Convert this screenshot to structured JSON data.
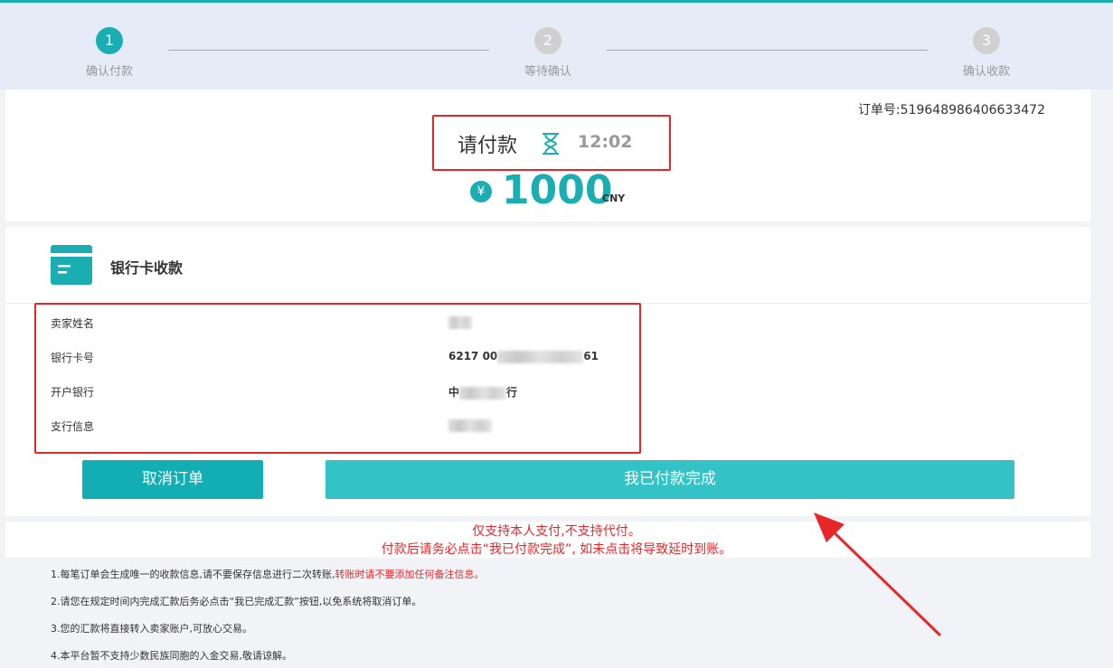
{
  "steps": [
    {
      "num": "1",
      "label": "确认付款"
    },
    {
      "num": "2",
      "label": "等待确认"
    },
    {
      "num": "3",
      "label": "确认收款"
    }
  ],
  "order": {
    "label": "订单号:",
    "number": "519648986406633472"
  },
  "pay": {
    "title": "请付款",
    "timer": "12:02",
    "currency_symbol": "¥",
    "amount": "1000",
    "currency": "CNY"
  },
  "bank": {
    "title": "银行卡收款",
    "rows": [
      {
        "key": "卖家姓名",
        "value_prefix": "",
        "value_suffix": ""
      },
      {
        "key": "银行卡号",
        "value_prefix": "6217 00",
        "value_suffix": "61"
      },
      {
        "key": "开户银行",
        "value_prefix": "中",
        "value_suffix": "行"
      },
      {
        "key": "支行信息",
        "value_prefix": "",
        "value_suffix": ""
      }
    ]
  },
  "buttons": {
    "cancel": "取消订单",
    "done": "我已付款完成"
  },
  "warnings": [
    "仅支持本人支付,不支持代付。",
    "付款后请务必点击“我已付款完成”, 如未点击将导致延时到账。"
  ],
  "notes": [
    {
      "text": "1.每笔订单会生成唯一的收款信息,请不要保存信息进行二次转账,",
      "red": "转账时请不要添加任何备注信息。"
    },
    {
      "text": "2.请您在规定时间内完成汇款后务必点击“我已完成汇款”按钮,以免系统将取消订单。",
      "red": ""
    },
    {
      "text": "3.您的汇款将直接转入卖家账户,可放心交易。",
      "red": ""
    },
    {
      "text": "4.本平台暂不支持少数民族同胞的入金交易,敬请谅解。",
      "red": ""
    }
  ],
  "colors": {
    "accent": "#1aaeb3",
    "button_done": "#33c2c6",
    "alert": "#e8262a"
  }
}
